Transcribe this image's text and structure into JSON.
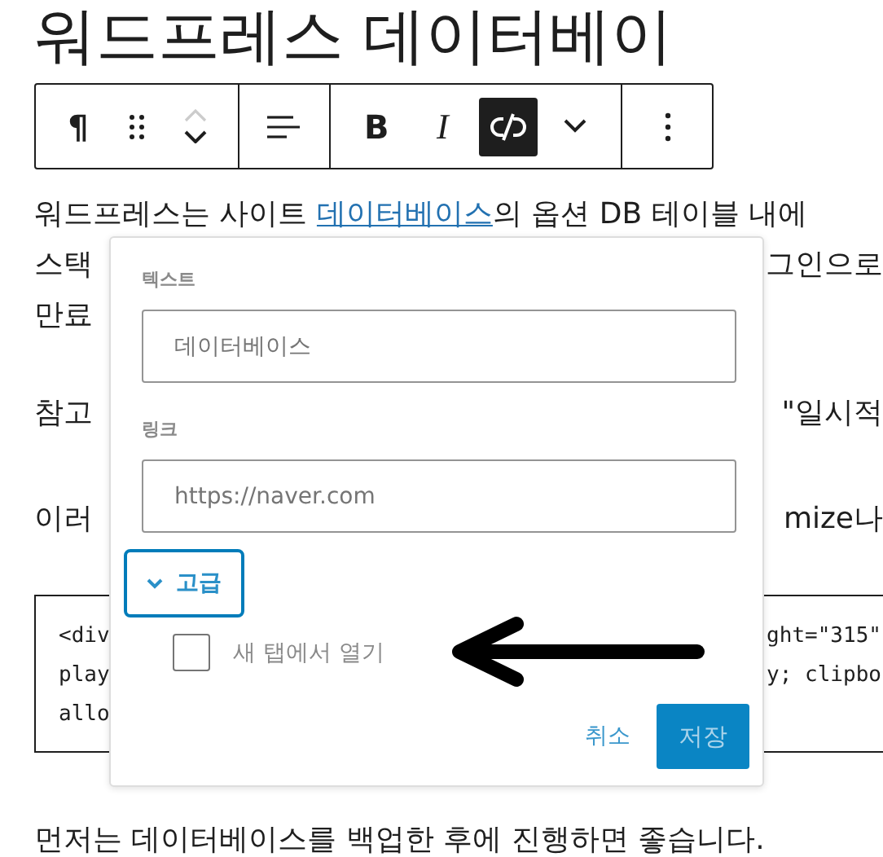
{
  "heading": "워드프레스 데이터베이",
  "toolbar": {
    "groups": [
      [
        {
          "kind": "paragraph",
          "label": "¶",
          "pressed": false
        },
        {
          "kind": "drag",
          "pressed": false
        },
        {
          "kind": "mover",
          "pressed": false,
          "up_disabled": true
        }
      ],
      [
        {
          "kind": "align",
          "pressed": false
        }
      ],
      [
        {
          "kind": "bold",
          "label": "B",
          "pressed": false
        },
        {
          "kind": "italic",
          "label": "I",
          "pressed": false
        },
        {
          "kind": "link",
          "pressed": true
        },
        {
          "kind": "more",
          "pressed": false
        }
      ],
      [
        {
          "kind": "options",
          "pressed": false
        }
      ]
    ]
  },
  "content": [
    {
      "kind": "paragraph",
      "lines": [
        {
          "left": [
            {
              "text": "워드프레스는 사이트 "
            },
            {
              "text": "데이터베이스",
              "link": true
            },
            {
              "text": "의 옵션 DB 테이블 내에"
            }
          ]
        },
        {
          "left": [
            {
              "text": "스택"
            }
          ],
          "right": "그인으로"
        },
        {
          "left": [
            {
              "text": "만료"
            }
          ]
        }
      ]
    },
    {
      "kind": "paragraph",
      "lines": [
        {
          "left": [
            {
              "text": "참고"
            }
          ],
          "right": "\"일시적"
        }
      ]
    },
    {
      "kind": "paragraph",
      "lines": [
        {
          "left": [
            {
              "text": "이러"
            }
          ],
          "right": "mize나"
        }
      ]
    },
    {
      "kind": "code",
      "lines": [
        {
          "left": "<div",
          "right": "ght=\"315\""
        },
        {
          "left": "play",
          "right": "y; clipbo"
        },
        {
          "left": "allo"
        }
      ]
    },
    {
      "kind": "paragraph",
      "lines": [
        {
          "left": [
            {
              "text": "먼저는 데이터베이스를 백업한 후에 진행하면 좋습니다."
            }
          ]
        }
      ]
    }
  ],
  "popover": {
    "text_label": "텍스트",
    "text_value": "데이터베이스",
    "link_label": "링크",
    "link_value": "https://naver.com",
    "advanced": {
      "label": "고급",
      "expanded": true
    },
    "new_tab": {
      "label": "새 탭에서 열기",
      "checked": false
    },
    "cancel": "취소",
    "save": "저장"
  }
}
